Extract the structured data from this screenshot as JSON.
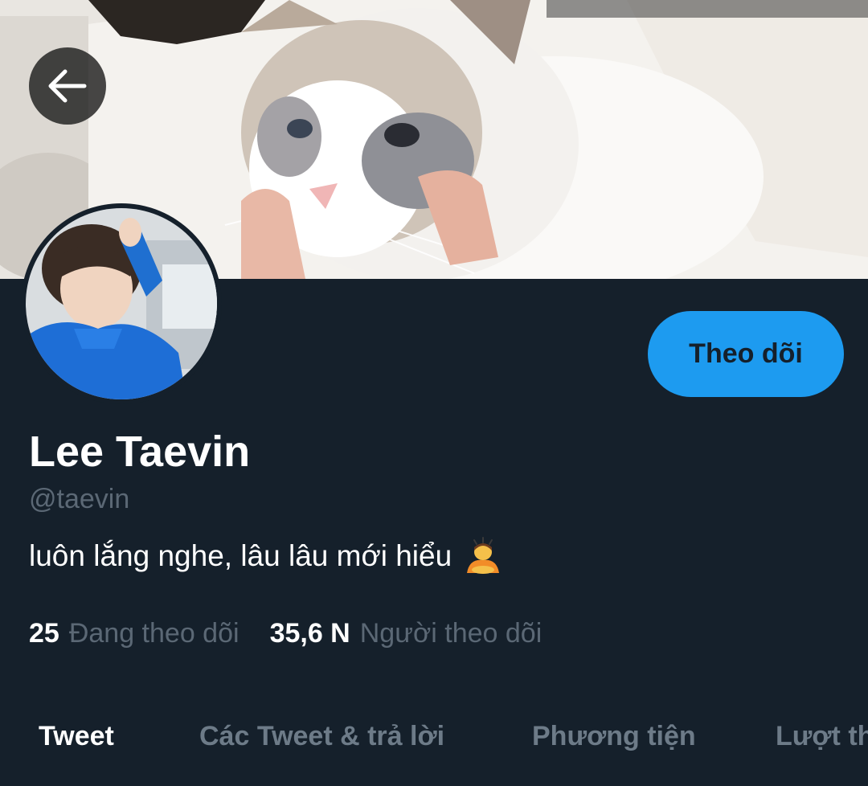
{
  "header": {
    "back_icon": "arrow-left-icon",
    "banner_image": "cover-photo"
  },
  "profile": {
    "display_name": "Lee Taevin",
    "handle": "@taevin",
    "bio": "luôn lắng nghe, lâu lâu mới hiểu",
    "bio_emoji": "person-bowing-emoji",
    "follow_label": "Theo dõi"
  },
  "stats": {
    "following_count": "25",
    "following_label": "Đang theo dõi",
    "followers_count": "35,6 N",
    "followers_label": "Người theo dõi"
  },
  "tabs": [
    {
      "label": "Tweet",
      "active": true
    },
    {
      "label": "Các Tweet & trả lời",
      "active": false
    },
    {
      "label": "Phương tiện",
      "active": false
    },
    {
      "label": "Lượt thích",
      "active": false
    }
  ],
  "colors": {
    "background": "#15202b",
    "accent": "#1d9bf0",
    "secondary_text": "#5b6875",
    "primary_text": "#ffffff"
  }
}
